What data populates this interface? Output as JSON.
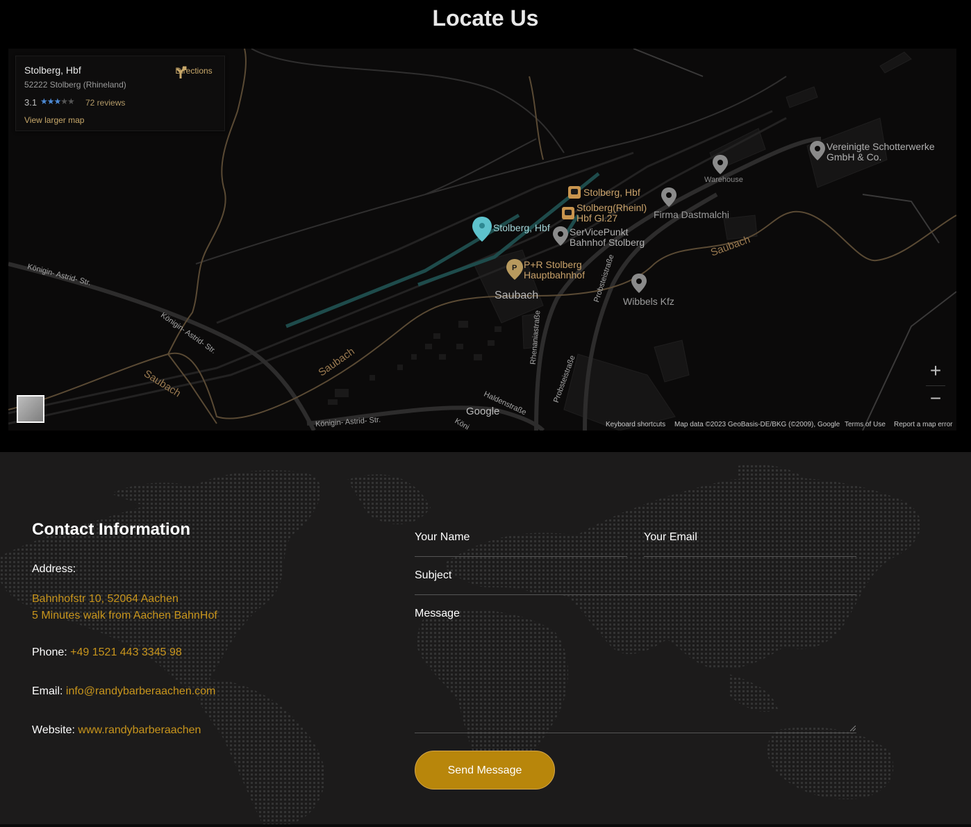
{
  "page": {
    "title": "Locate Us"
  },
  "map_card": {
    "name": "Stolberg, Hbf",
    "address": "52222 Stolberg (Rhineland)",
    "rating": "3.1",
    "stars": "★★★",
    "stars_off": "★★",
    "reviews": "72 reviews",
    "larger_map": "View larger map",
    "directions": "Directions"
  },
  "map_labels": {
    "main_pin": "Stolberg, Hbf",
    "station_1": "Stolberg, Hbf",
    "station_2a": "Stolberg(Rheinl)",
    "station_2b": "Hbf Gl.27",
    "service_a": "SerVicePunkt",
    "service_b": "Bahnhof Stolberg",
    "parking_a": "P+R Stolberg",
    "parking_b": "Hauptbahnhof",
    "area": "Saubach",
    "warehouse": "Warehouse",
    "firma": "Firma Dastmalchi",
    "schotter_a": "Vereinigte Schotterwerke",
    "schotter_b": "GmbH & Co.",
    "wibbels": "Wibbels Kfz",
    "saubach_1": "Saubach",
    "saubach_2": "Saubach",
    "saubach_3": "Saubach",
    "road_koenigin_1": "Königin- Astrid- Str.",
    "road_koenigin_2": "Königin- Astrid- Str.",
    "road_koenigin_3": "Königin- Astrid- Str.",
    "road_koenigin_4": "Köni",
    "road_rhenania": "Rhenaniastraße",
    "road_probst_1": "Probsteistraße",
    "road_probst_2": "Probsteistraße",
    "road_halden": "Haldenstraße",
    "google": "Google"
  },
  "map_controls": {
    "zoom_in": "+",
    "zoom_out": "−",
    "keyboard": "Keyboard shortcuts",
    "map_data": "Map data ©2023 GeoBasis-DE/BKG (©2009), Google",
    "terms": "Terms of Use",
    "report": "Report a map error"
  },
  "contact": {
    "title": "Contact Information",
    "address_label": "Address:",
    "address_line1": "Bahnhofstr 10, 52064 Aachen",
    "address_line2": "5 Minutes walk from Aachen BahnHof",
    "phone_label": "Phone: ",
    "phone": "+49 1521 443 3345 98",
    "email_label": "Email: ",
    "email": "info@randybarberaachen.com",
    "website_label": "Website: ",
    "website": "www.randybarberaachen"
  },
  "form": {
    "name_placeholder": "Your Name",
    "email_placeholder": "Your Email",
    "subject_placeholder": "Subject",
    "message_placeholder": "Message",
    "submit": "Send Message"
  },
  "colors": {
    "accent": "#b8860b",
    "link": "#c8951c",
    "map_bg": "#0b0a0a",
    "section_bg": "#1c1b1b"
  }
}
